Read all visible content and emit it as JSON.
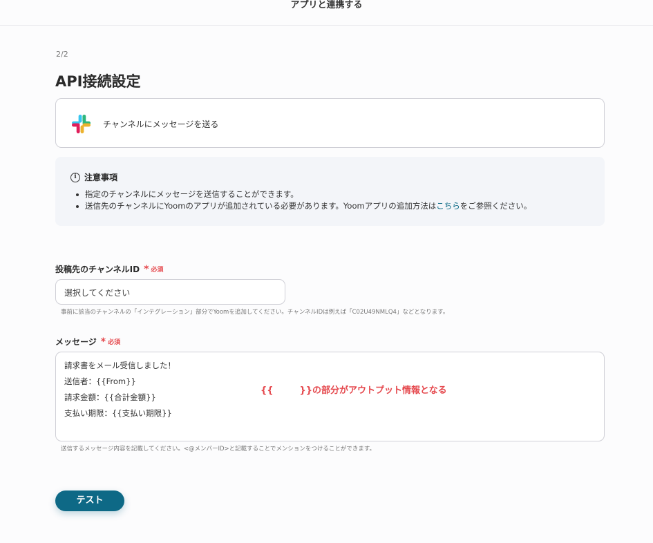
{
  "header": {
    "title": "アプリと連携する"
  },
  "step": "2/2",
  "page_title": "API接続設定",
  "action_card": {
    "app_icon": "slack-icon",
    "label": "チャンネルにメッセージを送る"
  },
  "notice": {
    "title": "注意事項",
    "items": [
      "指定のチャンネルにメッセージを送信することができます。",
      "送信先のチャンネルにYoomのアプリが追加されている必要があります。Yoomアプリの追加方法は"
    ],
    "link_text": "こちら",
    "link_suffix": "をご参照ください。"
  },
  "channel_field": {
    "label": "投稿先のチャンネルID",
    "required": "必須",
    "placeholder": "選択してください",
    "help": "事前に該当のチャンネルの「インテグレーション」部分でYoomを追加してください。チャンネルIDは例えば「C02U49NMLQ4」などとなります。"
  },
  "message_field": {
    "label": "メッセージ",
    "required": "必須",
    "lines": [
      "請求書をメール受信しました！",
      "送信者：{{From}}",
      "請求金額：{{合計金額}}",
      "支払い期限：{{支払い期限}}"
    ],
    "annotation_left": "{{",
    "annotation_right": "}}の部分がアウトプット情報となる",
    "help": "送信するメッセージ内容を記載してください。<@メンバーID>と記載することでメンションをつけることができます。"
  },
  "test_button": {
    "label": "テスト"
  },
  "colors": {
    "accent": "#0e6986",
    "required": "#e5484d",
    "link": "#0d6b86"
  }
}
